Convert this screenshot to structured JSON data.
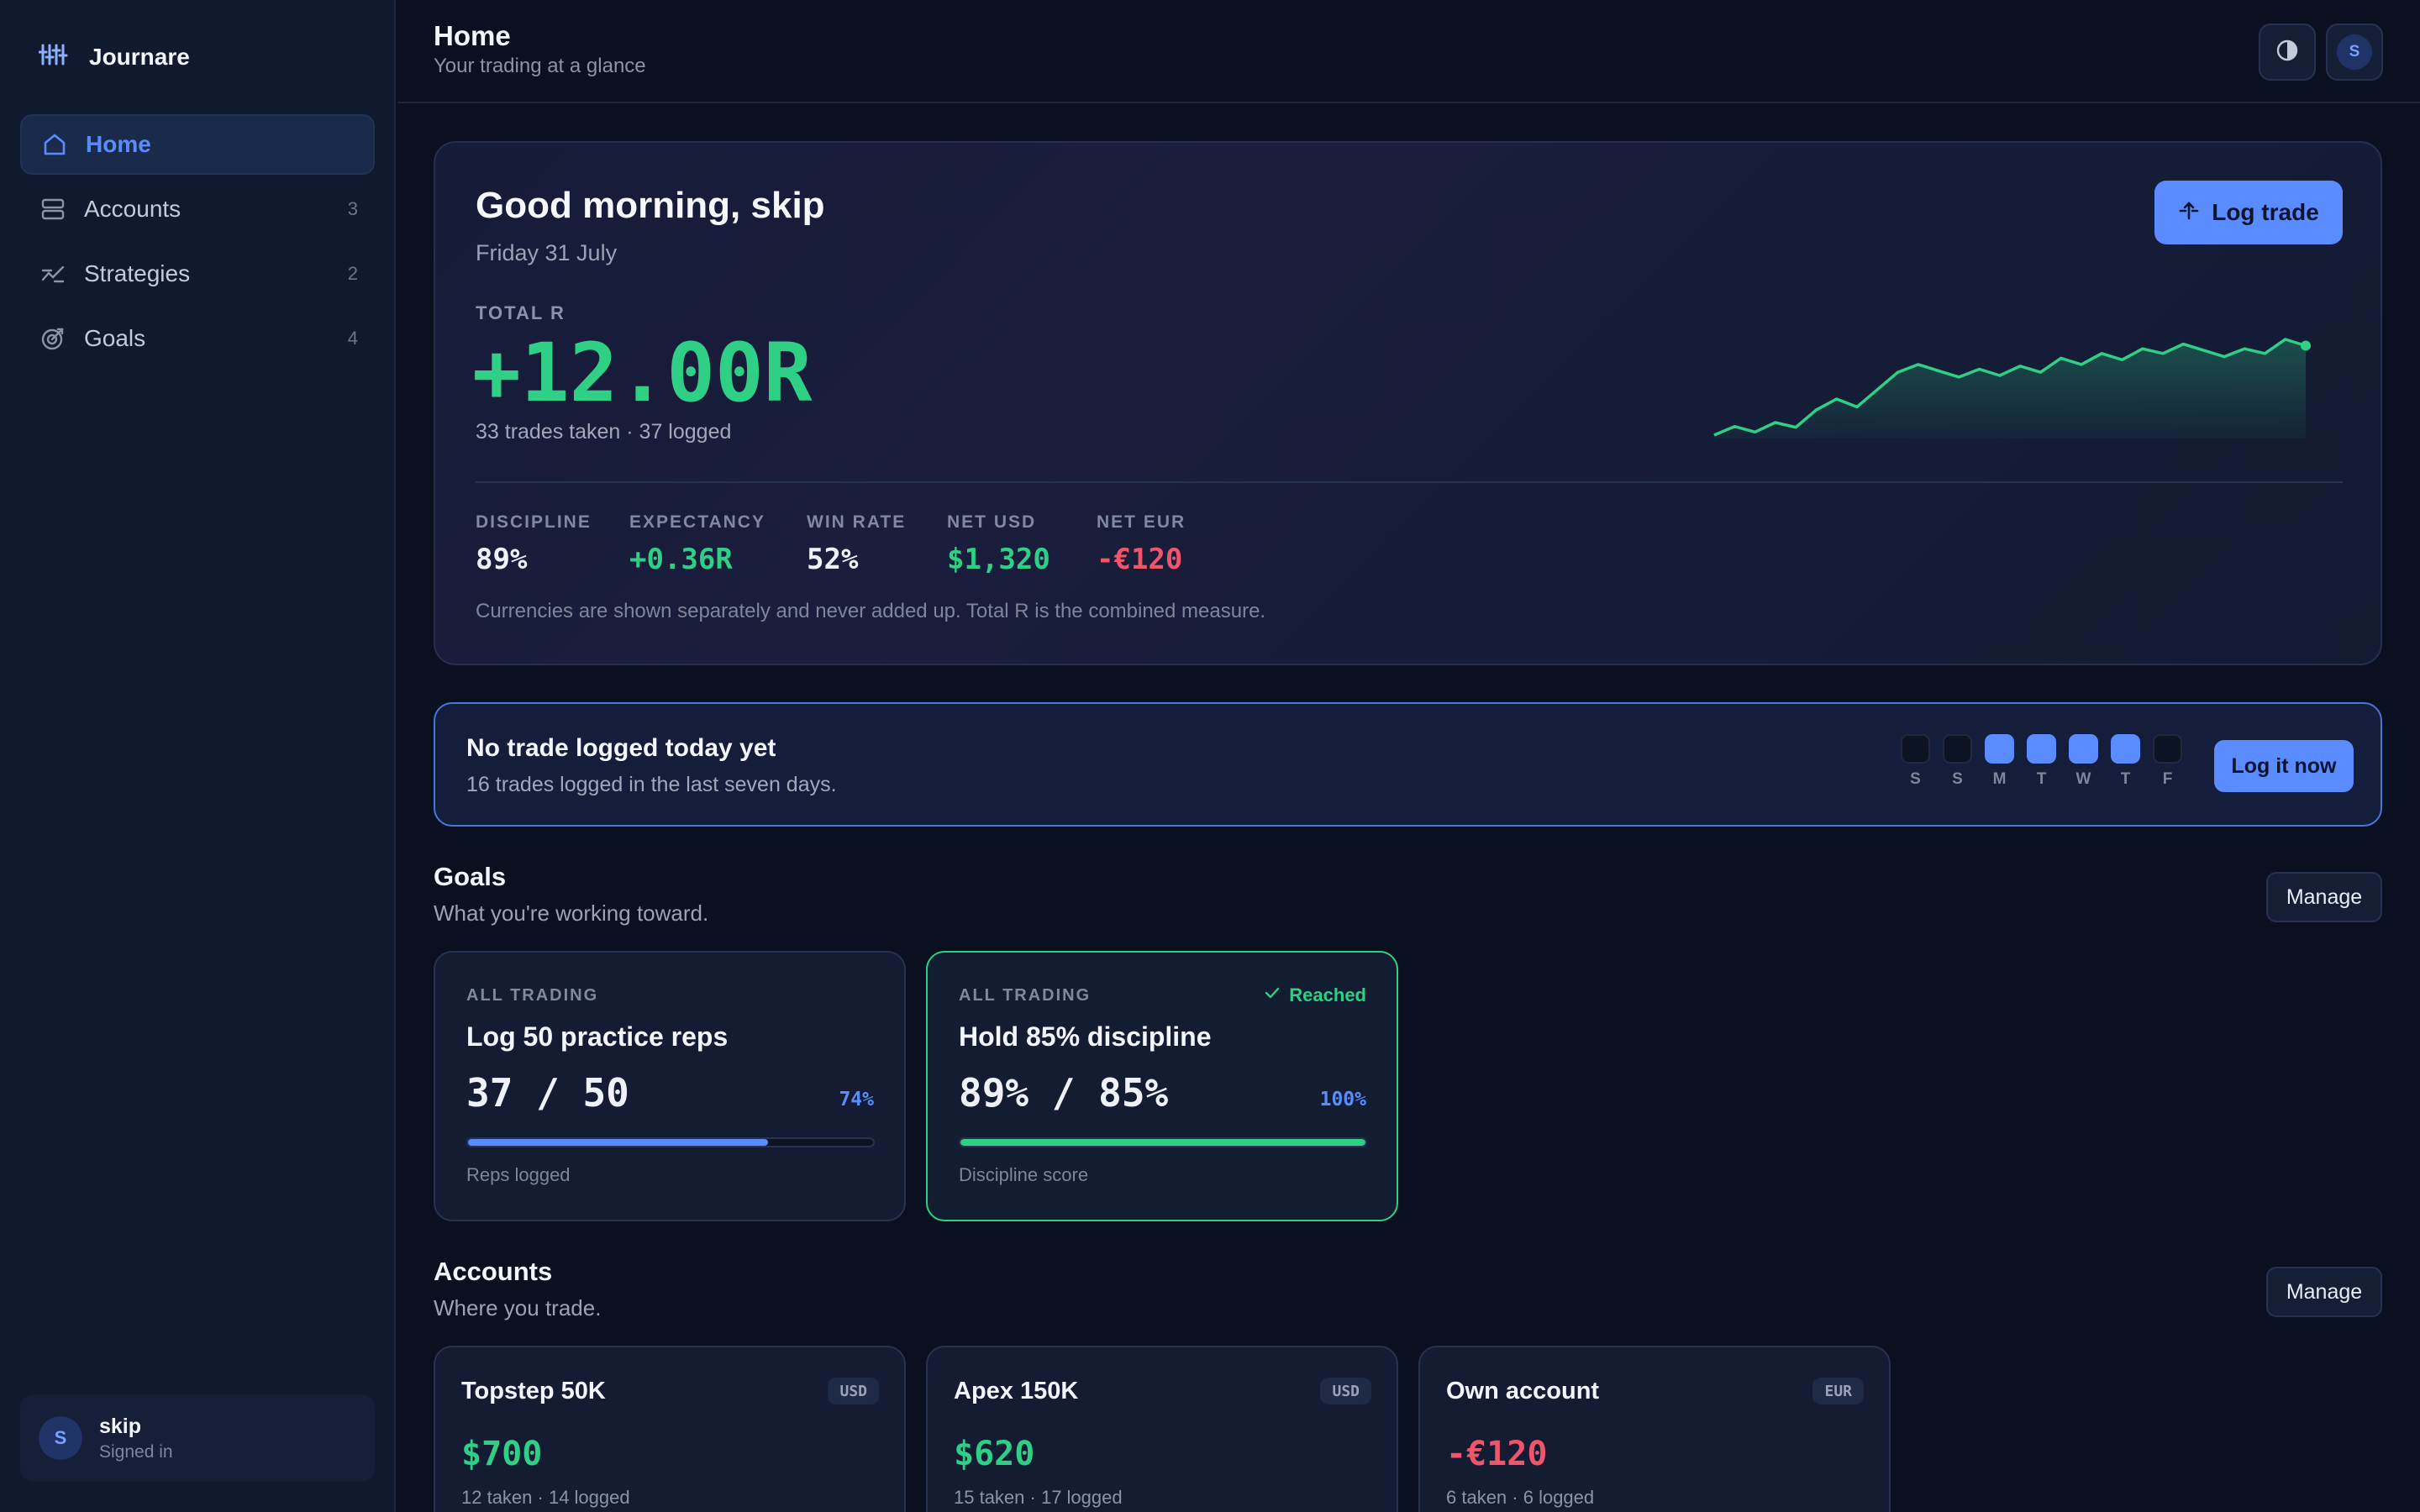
{
  "app": {
    "name": "Journare"
  },
  "sidebar": {
    "items": [
      {
        "label": "Home",
        "count": ""
      },
      {
        "label": "Accounts",
        "count": "3"
      },
      {
        "label": "Strategies",
        "count": "2"
      },
      {
        "label": "Goals",
        "count": "4"
      }
    ],
    "user": {
      "initial": "S",
      "name": "skip",
      "status": "Signed in"
    }
  },
  "header": {
    "title": "Home",
    "subtitle": "Your trading at a glance",
    "avatar_initial": "S"
  },
  "hero": {
    "greeting": "Good morning, skip",
    "date": "Friday 31 July",
    "total_label": "TOTAL R",
    "total_value": "+12.00R",
    "trades_note": "33 trades taken · 37 logged",
    "log_trade_label": "Log trade",
    "stats": [
      {
        "label": "DISCIPLINE",
        "value": "89%",
        "color": "#eef1f7"
      },
      {
        "label": "EXPECTANCY",
        "value": "+0.36R",
        "color": "#2fcf86"
      },
      {
        "label": "WIN RATE",
        "value": "52%",
        "color": "#eef1f7"
      },
      {
        "label": "NET USD",
        "value": "$1,320",
        "color": "#2fcf86"
      },
      {
        "label": "NET EUR",
        "value": "-€120",
        "color": "#f0556a"
      }
    ],
    "footnote": "Currencies are shown separately and never added up. Total R is the combined measure.",
    "sparkline": [
      0.0,
      0.55,
      0.2,
      0.8,
      0.5,
      1.6,
      2.3,
      1.8,
      2.9,
      4.0,
      4.5,
      4.1,
      3.7,
      4.2,
      3.8,
      4.4,
      4.0,
      4.9,
      4.5,
      5.2,
      4.8,
      5.5,
      5.2,
      5.8,
      5.4,
      5.0,
      5.5,
      5.2,
      6.1,
      5.7
    ]
  },
  "banner": {
    "title": "No trade logged today yet",
    "subtitle": "16 trades logged in the last seven days.",
    "days": [
      {
        "letter": "S",
        "logged": false
      },
      {
        "letter": "S",
        "logged": false
      },
      {
        "letter": "M",
        "logged": true
      },
      {
        "letter": "T",
        "logged": true
      },
      {
        "letter": "W",
        "logged": true
      },
      {
        "letter": "T",
        "logged": true
      },
      {
        "letter": "F",
        "logged": false
      }
    ],
    "button_label": "Log it now"
  },
  "goals": {
    "title": "Goals",
    "subtitle": "What you're working toward.",
    "manage_label": "Manage",
    "cards": [
      {
        "scope": "ALL TRADING",
        "badge": "",
        "name": "Log 50 practice reps",
        "progress": "37 / 50",
        "percent": "74%",
        "fraction": 0.74,
        "metric": "Reps logged",
        "bar_color": "#5b8cff"
      },
      {
        "scope": "ALL TRADING",
        "badge": "Reached",
        "name": "Hold 85% discipline",
        "progress": "89% / 85%",
        "percent": "100%",
        "fraction": 1.0,
        "metric": "Discipline score",
        "bar_color": "#2fcf86"
      }
    ]
  },
  "accounts": {
    "title": "Accounts",
    "subtitle": "Where you trade.",
    "manage_label": "Manage",
    "cards": [
      {
        "name": "Topstep 50K",
        "currency": "USD",
        "net": "$700",
        "net_color": "#2fcf86",
        "note": "12 taken · 14 logged"
      },
      {
        "name": "Apex 150K",
        "currency": "USD",
        "net": "$620",
        "net_color": "#2fcf86",
        "note": "15 taken · 17 logged"
      },
      {
        "name": "Own account",
        "currency": "EUR",
        "net": "-€120",
        "net_color": "#f0556a",
        "note": "6 taken · 6 logged"
      }
    ]
  },
  "colors": {
    "accent": "#5b8cff",
    "positive": "#2fcf86",
    "negative": "#f0556a"
  }
}
